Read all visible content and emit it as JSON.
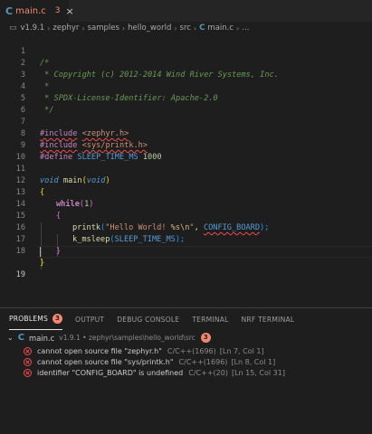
{
  "tab": {
    "icon": "c-language-icon",
    "label": "main.c",
    "problem_count": "3",
    "close": "×"
  },
  "breadcrumb": {
    "items": [
      "v1.9.1",
      "zephyr",
      "samples",
      "hello_world",
      "src"
    ],
    "file": "main.c",
    "more": "..."
  },
  "editor": {
    "line_numbers": [
      "1",
      "2",
      "3",
      "4",
      "5",
      "6",
      "7",
      "8",
      "9",
      "10",
      "11",
      "12",
      "13",
      "14",
      "15",
      "16",
      "17",
      "18",
      "19"
    ],
    "lines": {
      "l1": "/*",
      "l2": " * Copyright (c) 2012-2014 Wind River Systems, Inc.",
      "l3": " *",
      "l4": " * SPDX-License-Identifier: Apache-2.0",
      "l5": " */",
      "l7_dir": "#include",
      "l7_arg": "<zephyr.h>",
      "l8_dir": "#include",
      "l8_arg": "<sys/printk.h>",
      "l9_dir": "#define",
      "l9_name": "SLEEP_TIME_MS",
      "l9_val": "1000",
      "l11_type": "void",
      "l11_fn": "main",
      "l11_open": "(",
      "l11_param": "void",
      "l11_close": ")",
      "l12": "{",
      "l13_kw": "while",
      "l13_open": "(",
      "l13_num": "1",
      "l13_close": ")",
      "l14": "{",
      "l15_fn": "printk",
      "l15_open": "(",
      "l15_str1": "\"Hello World! ",
      "l15_esc1": "%s",
      "l15_esc2": "\\n",
      "l15_str2": "\"",
      "l15_comma": ", ",
      "l15_arg": "CONFIG_BOARD",
      "l15_close": ");",
      "l16_fn": "k_msleep",
      "l16_open": "(",
      "l16_arg": "SLEEP_TIME_MS",
      "l16_close": ");",
      "l17": "}",
      "l18": "}"
    }
  },
  "panel": {
    "tabs": [
      "PROBLEMS",
      "OUTPUT",
      "DEBUG CONSOLE",
      "TERMINAL",
      "NRF TERMINAL"
    ],
    "problems_count": "3",
    "file_group": {
      "name": "main.c",
      "path": "v1.9.1 • zephyr\\samples\\hello_world\\src",
      "count": "3"
    },
    "problems": [
      {
        "message": "cannot open source file \"zephyr.h\"",
        "source": "C/C++(1696)",
        "location": "[Ln 7, Col 1]"
      },
      {
        "message": "cannot open source file \"sys/printk.h\"",
        "source": "C/C++(1696)",
        "location": "[Ln 8, Col 1]"
      },
      {
        "message": "identifier \"CONFIG_BOARD\" is undefined",
        "source": "C/C++(20)",
        "location": "[Ln 15, Col 31]"
      }
    ]
  },
  "colors": {
    "error": "#f14c4c",
    "badge": "#f48771",
    "c_icon": "#519aba"
  }
}
